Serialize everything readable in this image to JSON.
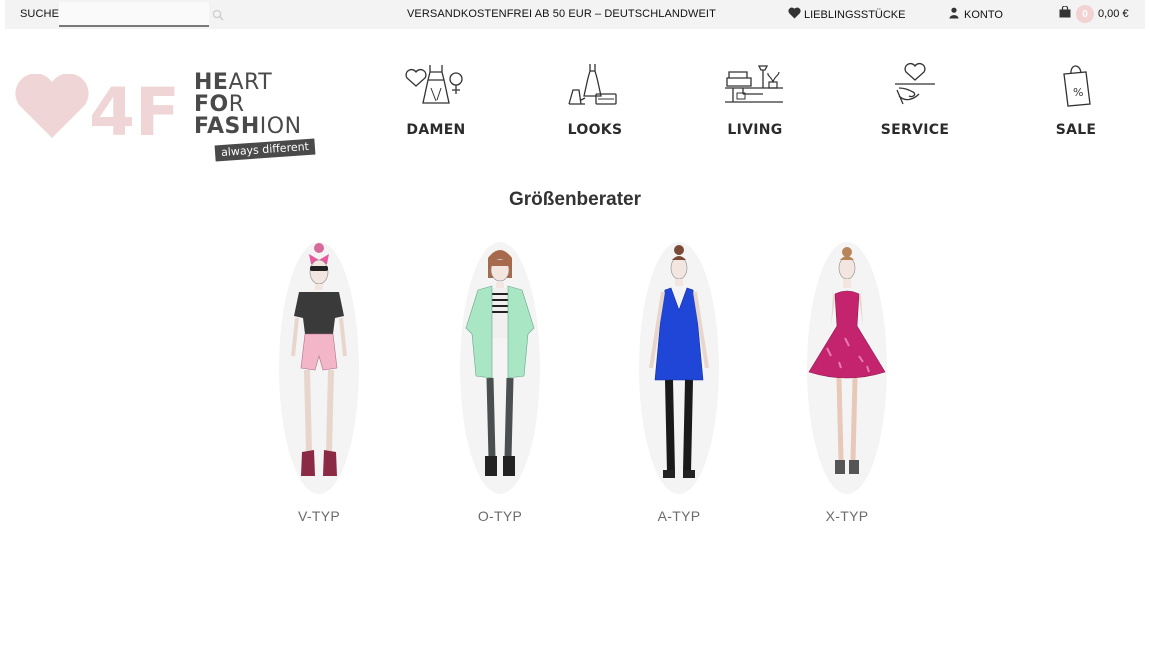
{
  "topbar": {
    "search_label": "SUCHE",
    "search_value": "",
    "search_placeholder": "",
    "shipping_notice": "VERSANDKOSTENFREI AB 50 EUR – DEUTSCHLANDWEIT",
    "wishlist_label": "LIEBLINGSSTÜCKE",
    "account_label": "KONTO",
    "cart_count": "0",
    "cart_total": "0,00 €"
  },
  "logo": {
    "mark": "4F",
    "line1_bold": "HE",
    "line1_thin": "ART",
    "line2_bold": "FO",
    "line2_thin": "R",
    "line3_bold": "FASH",
    "line3_thin": "ION",
    "tagline": "always different",
    "mark_color": "#efd5d5"
  },
  "nav": {
    "items": [
      {
        "label": "DAMEN",
        "icon": "dress-icon"
      },
      {
        "label": "LOOKS",
        "icon": "outfit-icon"
      },
      {
        "label": "LIVING",
        "icon": "furniture-icon"
      },
      {
        "label": "SERVICE",
        "icon": "heart-hand-icon"
      },
      {
        "label": "SALE",
        "icon": "sale-bag-icon"
      }
    ]
  },
  "main": {
    "title": "Größenberater",
    "types": [
      {
        "label": "V-TYP",
        "outfit_color": "#3a3a3a",
        "bottom_color": "#f2b6c8"
      },
      {
        "label": "O-TYP",
        "outfit_color": "#a8e6c4",
        "bottom_color": "#4a5050"
      },
      {
        "label": "A-TYP",
        "outfit_color": "#1f46d6",
        "bottom_color": "#1a1a1a"
      },
      {
        "label": "X-TYP",
        "outfit_color": "#c4246e",
        "bottom_color": "#e8c8b8"
      }
    ]
  }
}
